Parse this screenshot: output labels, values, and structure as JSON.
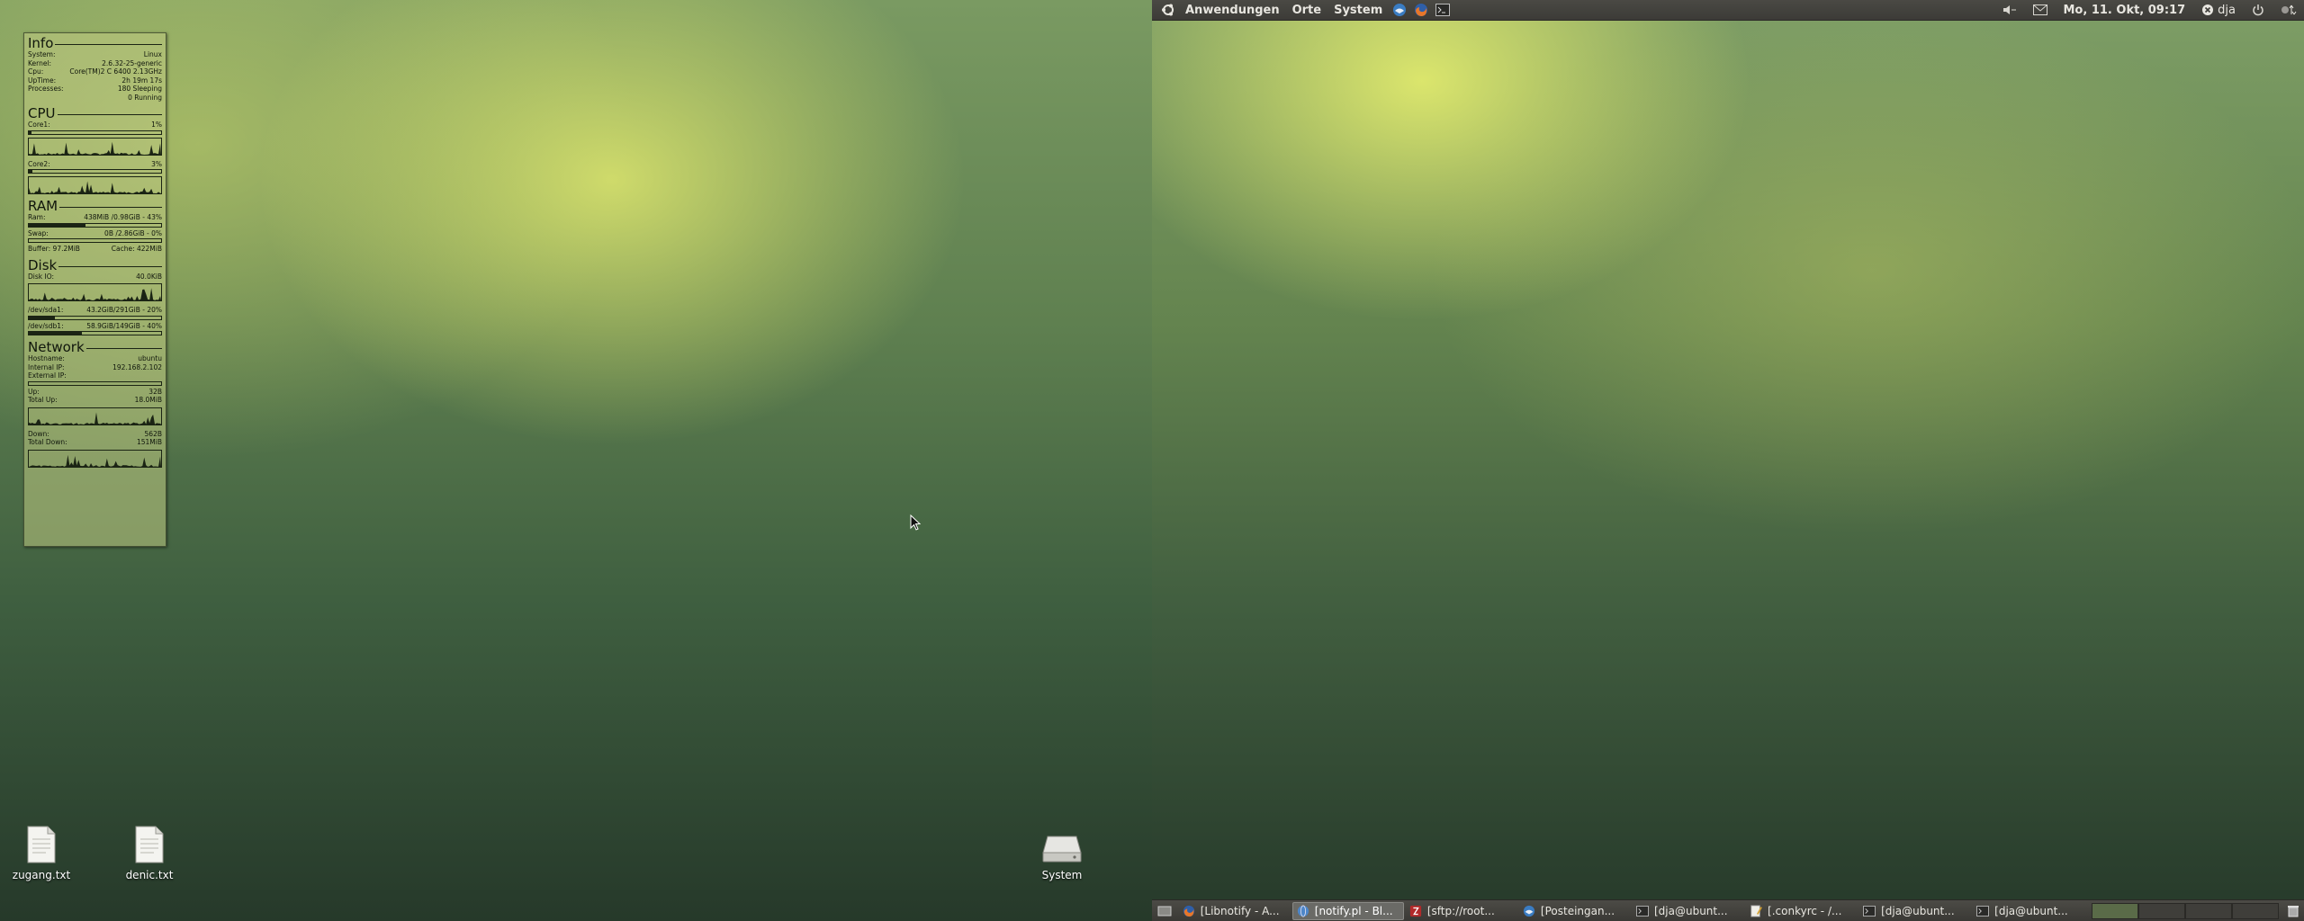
{
  "conky": {
    "info": {
      "title": "Info",
      "rows": [
        {
          "label": "System:",
          "value": "Linux"
        },
        {
          "label": "Kernel:",
          "value": "2.6.32-25-generic"
        },
        {
          "label": "Cpu:",
          "value": "Core(TM)2 C   6400 2.13GHz"
        },
        {
          "label": "UpTime:",
          "value": "2h 19m 17s"
        },
        {
          "label": "Processes:",
          "value": "180  Sleeping"
        },
        {
          "label": "",
          "value": "0   Running"
        }
      ]
    },
    "cpu": {
      "title": "CPU",
      "core1_label": "Core1:",
      "core1_value": "1%",
      "core1_level": 0.01,
      "core2_label": "Core2:",
      "core2_value": "3%",
      "core2_level": 0.03
    },
    "ram": {
      "title": "RAM",
      "ram_label": "Ram:",
      "ram_value": "438MiB /0.98GiB - 43%",
      "ram_level": 0.43,
      "swap_label": "Swap:",
      "swap_value": "0B    /2.86GiB - 0%",
      "swap_level": 0.0,
      "buffer_label": "Buffer: 97.2MiB",
      "cache_label": "Cache: 422MiB"
    },
    "disk": {
      "title": "Disk",
      "io_label": "Disk IO:",
      "io_value": "40.0KiB",
      "sda1_label": "/dev/sda1:",
      "sda1_value": "43.2GiB/291GiB - 20%",
      "sda1_level": 0.2,
      "sdb1_label": "/dev/sdb1:",
      "sdb1_value": "58.9GiB/149GiB - 40%",
      "sdb1_level": 0.4
    },
    "network": {
      "title": "Network",
      "hostname_label": "Hostname:",
      "hostname_value": "ubuntu",
      "internal_label": "Internal IP:",
      "internal_value": "192.168.2.102",
      "external_label": "External IP:",
      "external_value": "",
      "up_label": "Up:",
      "up_value": "32B",
      "totalup_label": "Total Up:",
      "totalup_value": "18.0MiB",
      "down_label": "Down:",
      "down_value": "562B",
      "totaldown_label": "Total Down:",
      "totaldown_value": "151MiB"
    }
  },
  "desktop": {
    "icons": [
      {
        "label": "zugang.txt",
        "icon": "text-file-icon"
      },
      {
        "label": "denic.txt",
        "icon": "text-file-icon"
      },
      {
        "label": "System",
        "icon": "drive-icon"
      }
    ]
  },
  "top_panel": {
    "menu": [
      "Anwendungen",
      "Orte",
      "System"
    ],
    "launchers": [
      "thunderbird-icon",
      "firefox-icon",
      "terminal-icon"
    ],
    "clock": "Mo, 11. Okt, 09:17",
    "user": "dja",
    "tray": [
      "volume-icon",
      "mail-icon",
      "chat-status-icon",
      "power-icon",
      "network-icon"
    ]
  },
  "bottom_panel": {
    "tasks": [
      {
        "label": "[Libnotify - A...",
        "icon": "firefox-icon",
        "active": false
      },
      {
        "label": "[notify.pl - Bl...",
        "icon": "browser-icon",
        "active": true
      },
      {
        "label": "[sftp://root...",
        "icon": "filezilla-icon",
        "active": false
      },
      {
        "label": "[Posteingan...",
        "icon": "thunderbird-icon",
        "active": false
      },
      {
        "label": "[dja@ubunt...",
        "icon": "terminal-icon",
        "active": false
      },
      {
        "label": "[.conkyrc - /...",
        "icon": "editor-icon",
        "active": false
      },
      {
        "label": "[dja@ubunt...",
        "icon": "terminal-icon",
        "active": false
      },
      {
        "label": "[dja@ubunt...",
        "icon": "terminal-icon",
        "active": false
      }
    ],
    "workspaces": 4
  }
}
